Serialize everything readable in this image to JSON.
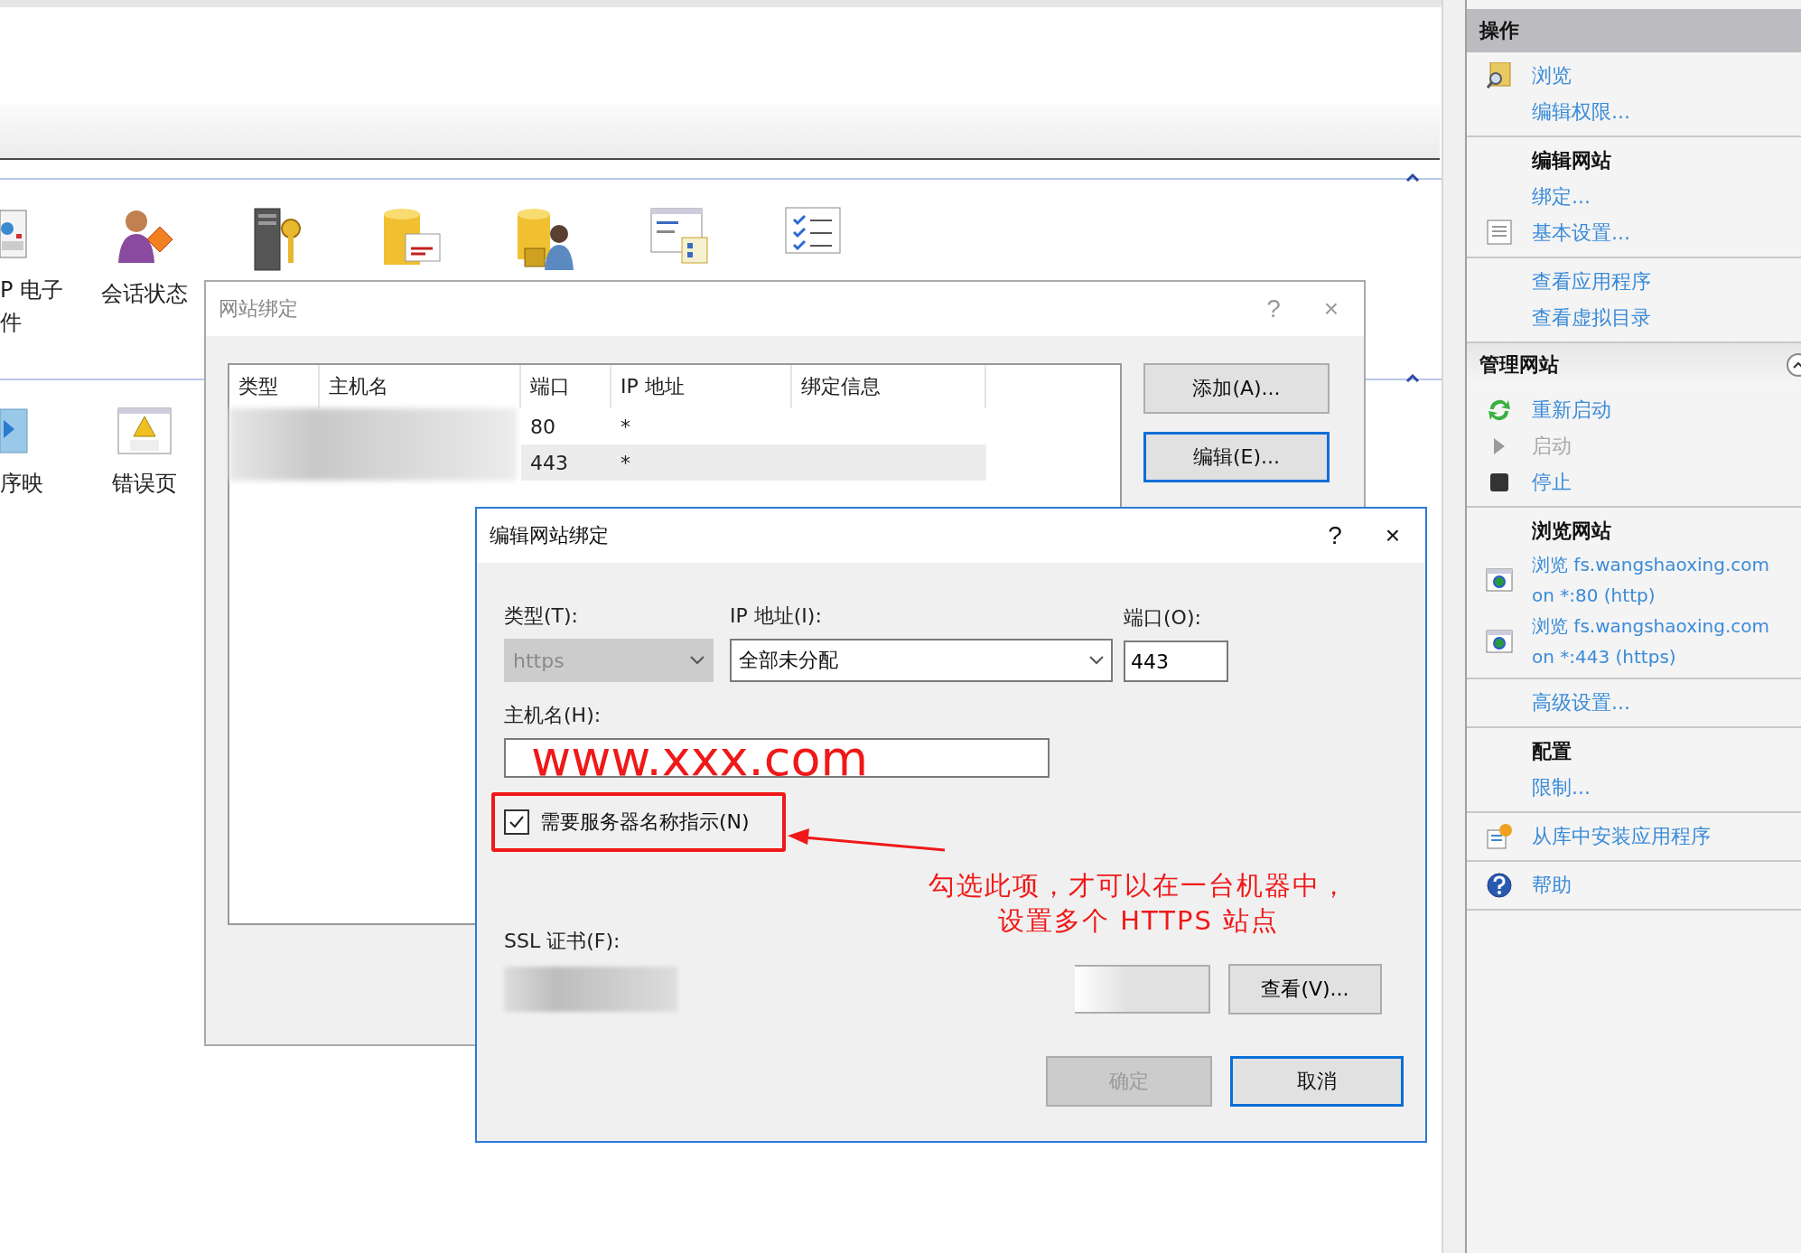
{
  "features": [
    {
      "items": [
        {
          "kind": "mail",
          "label_lines": [
            "P 电子",
            "件"
          ]
        },
        {
          "kind": "session",
          "label": "会话状态"
        },
        {
          "kind": "machine-key"
        },
        {
          "kind": "conn-string"
        },
        {
          "kind": "providers"
        },
        {
          "kind": "pages"
        },
        {
          "kind": "app-settings"
        }
      ]
    },
    {
      "items": [
        {
          "kind": "handler",
          "label_lines": [
            "序映"
          ]
        },
        {
          "kind": "error-page",
          "label": "错误页"
        }
      ]
    }
  ],
  "bindings_dialog": {
    "title": "网站绑定",
    "columns": [
      "类型",
      "主机名",
      "端口",
      "IP 地址",
      "绑定信息"
    ],
    "rows": [
      {
        "port": "80",
        "ip": "*",
        "selected": false
      },
      {
        "port": "443",
        "ip": "*",
        "selected": true
      }
    ],
    "buttons": [
      {
        "label": "添加(A)...",
        "default": false
      },
      {
        "label": "编辑(E)...",
        "default": true
      }
    ]
  },
  "edit_dialog": {
    "title": "编辑网站绑定",
    "help": "?",
    "close": "×",
    "type_label": "类型(T):",
    "type_value": "https",
    "type_disabled": true,
    "ip_label": "IP 地址(I):",
    "ip_value": "全部未分配",
    "port_label": "端口(O):",
    "port_value": "443",
    "host_label": "主机名(H):",
    "host_value": "www.xxx.com",
    "sni": {
      "label": "需要服务器名称指示(N)",
      "checked": true
    },
    "note_lines": [
      "勾选此项，才可以在一台机器中，",
      "设置多个 HTTPS 站点"
    ],
    "ssl_label": "SSL 证书(F):",
    "view_button": "查看(V)...",
    "buttons": [
      {
        "label": "确定",
        "disabled": true,
        "default": false
      },
      {
        "label": "取消",
        "disabled": false,
        "default": true
      }
    ]
  },
  "actions": [
    {
      "title": "操作",
      "collapsible": false,
      "groups": [
        {
          "items": [
            {
              "label": "浏览",
              "kind": "browse",
              "disabled": false
            },
            {
              "label": "编辑权限...",
              "kind": "plain",
              "disabled": false
            }
          ]
        },
        {
          "title": "编辑网站",
          "items": [
            {
              "label": "绑定...",
              "kind": "plain",
              "disabled": false
            },
            {
              "label": "基本设置...",
              "kind": "settings",
              "disabled": false
            }
          ]
        },
        {
          "items": [
            {
              "label": "查看应用程序",
              "kind": "plain",
              "disabled": false
            },
            {
              "label": "查看虚拟目录",
              "kind": "plain",
              "disabled": false
            }
          ]
        }
      ]
    },
    {
      "title": "管理网站",
      "collapsible": true,
      "groups": [
        {
          "items": [
            {
              "label": "重新启动",
              "kind": "restart",
              "disabled": false
            },
            {
              "label": "启动",
              "kind": "start",
              "disabled": true
            },
            {
              "label": "停止",
              "kind": "stop",
              "disabled": false
            }
          ]
        },
        {
          "title": "浏览网站",
          "items": [
            {
              "label": "浏览 fs.wangshaoxing.com on *:80 (http)",
              "kind": "site",
              "disabled": false
            },
            {
              "label": "浏览 fs.wangshaoxing.com on *:443 (https)",
              "kind": "site",
              "disabled": false
            }
          ]
        },
        {
          "items": [
            {
              "label": "高级设置...",
              "kind": "plain",
              "disabled": false
            }
          ]
        },
        {
          "title": "配置",
          "items": [
            {
              "label": "限制...",
              "kind": "plain",
              "disabled": false
            }
          ]
        },
        {
          "items": [
            {
              "label": "从库中安装应用程序",
              "kind": "install",
              "disabled": false
            }
          ]
        },
        {
          "items": [
            {
              "label": "帮助",
              "kind": "help",
              "disabled": false
            }
          ]
        }
      ]
    }
  ]
}
